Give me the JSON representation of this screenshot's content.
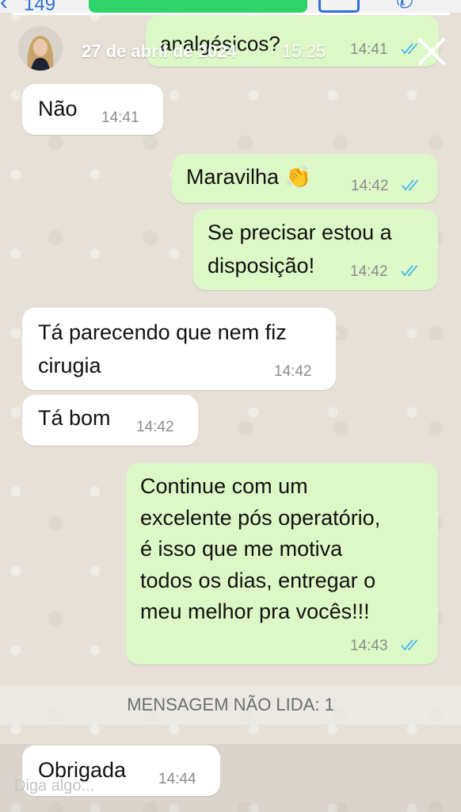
{
  "status_bar": {
    "count": "149"
  },
  "story": {
    "date": "27 de abril de 2024",
    "time": "15:25",
    "progress": 1.0
  },
  "colors": {
    "incoming_bubble": "#ffffff",
    "outgoing_bubble": "#dcf8c6",
    "read_ticks": "#53bdeb"
  },
  "messages": [
    {
      "direction": "out",
      "text": "analgésicos?",
      "time": "14:41",
      "read": true
    },
    {
      "direction": "in",
      "text": "Não",
      "time": "14:41"
    },
    {
      "direction": "out",
      "text": "Maravilha 👏",
      "time": "14:42",
      "read": true
    },
    {
      "direction": "out",
      "text": "Se precisar estou a\ndisposição!",
      "time": "14:42",
      "read": true
    },
    {
      "direction": "in",
      "text": "Tá parecendo que nem fiz\ncirugia",
      "time": "14:42"
    },
    {
      "direction": "in",
      "text": "Tá bom",
      "time": "14:42"
    },
    {
      "direction": "out",
      "text": "Continue com um\nexcelente pós operatório,\né isso que me motiva\ntodos os dias, entregar o\nmeu melhor pra vocês!!!",
      "time": "14:43",
      "read": true
    },
    {
      "direction": "in",
      "text": "Obrigada",
      "time": "14:44"
    }
  ],
  "unread_banner": "MENSAGEM NÃO LIDA: 1",
  "reply": {
    "placeholder": "Diga algo..."
  },
  "icons": [
    "back-icon",
    "video-call-icon",
    "voice-call-icon",
    "close-icon",
    "read-receipt-icon",
    "clapping-hands-emoji"
  ]
}
